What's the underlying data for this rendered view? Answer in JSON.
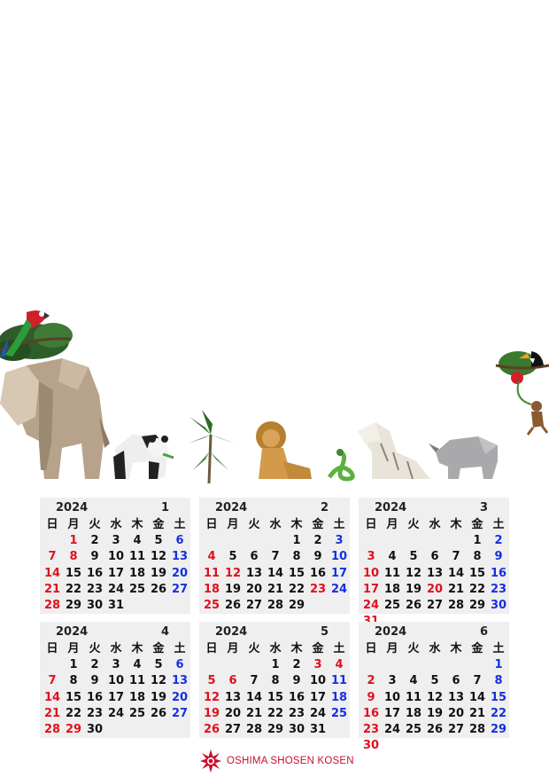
{
  "year": "2024",
  "weekdays": [
    "日",
    "月",
    "火",
    "水",
    "木",
    "金",
    "土"
  ],
  "months": [
    {
      "label": "1",
      "start": 1,
      "days": 31,
      "holidays": [
        1,
        8
      ]
    },
    {
      "label": "2",
      "start": 4,
      "days": 29,
      "holidays": [
        11,
        12,
        23
      ]
    },
    {
      "label": "3",
      "start": 5,
      "days": 31,
      "holidays": [
        20
      ]
    },
    {
      "label": "4",
      "start": 1,
      "days": 30,
      "holidays": [
        29
      ]
    },
    {
      "label": "5",
      "start": 3,
      "days": 31,
      "holidays": [
        3,
        4,
        5,
        6
      ]
    },
    {
      "label": "6",
      "start": 6,
      "days": 30,
      "holidays": []
    }
  ],
  "footer": {
    "company": "OSHIMA SHOSEN KOSEN"
  },
  "colors": {
    "sunday": "#e0101e",
    "saturday": "#1530e0",
    "logo": "#c8102e",
    "calendar_bg": "#efefef"
  }
}
